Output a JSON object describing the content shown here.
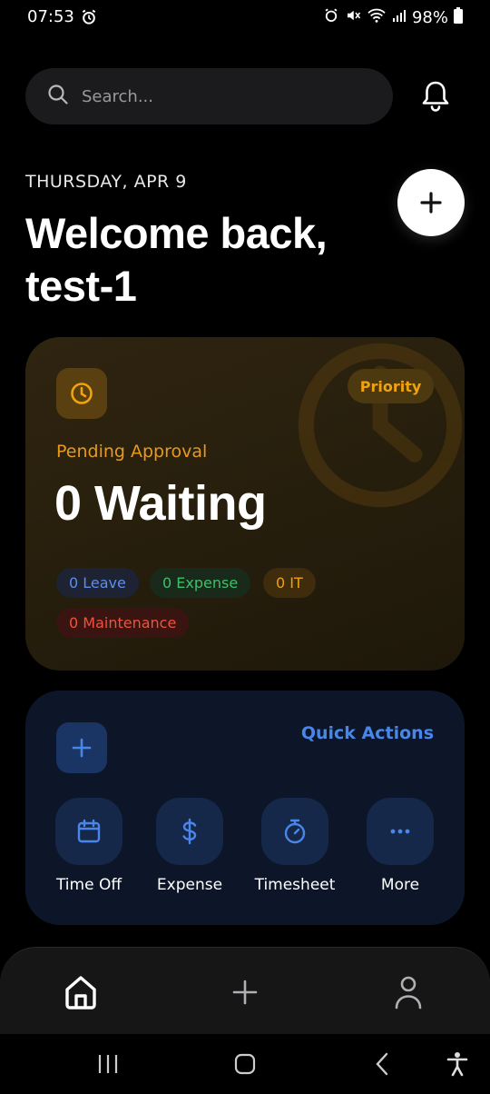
{
  "status_bar": {
    "time": "07:53",
    "battery": "98%"
  },
  "search": {
    "placeholder": "Search..."
  },
  "header": {
    "date": "THURSDAY, APR 9",
    "welcome_line1": "Welcome back,",
    "welcome_line2": "test-1"
  },
  "pending": {
    "priority_label": "Priority",
    "label": "Pending Approval",
    "count_text": "0 Waiting",
    "chips": [
      {
        "label": "0 Leave"
      },
      {
        "label": "0 Expense"
      },
      {
        "label": "0 IT"
      },
      {
        "label": "0 Maintenance"
      }
    ]
  },
  "quick_actions": {
    "title": "Quick Actions",
    "items": [
      {
        "label": "Time Off",
        "icon": "calendar-icon"
      },
      {
        "label": "Expense",
        "icon": "dollar-icon"
      },
      {
        "label": "Timesheet",
        "icon": "stopwatch-icon"
      },
      {
        "label": "More",
        "icon": "more-icon"
      }
    ]
  },
  "bottom_nav": {
    "items": [
      {
        "icon": "home-icon"
      },
      {
        "icon": "plus-icon"
      },
      {
        "icon": "profile-icon"
      }
    ]
  },
  "colors": {
    "background": "#000000",
    "pending_accent": "#f0a20f",
    "quick_accent": "#4a86ea",
    "leave": "#5d8ef0",
    "expense": "#3fbf6a",
    "maintenance": "#f0523c"
  }
}
